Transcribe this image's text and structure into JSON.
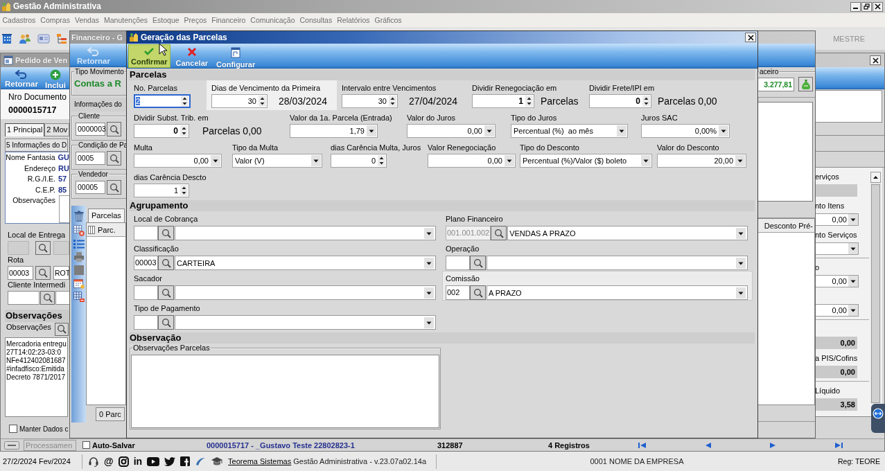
{
  "app_window": {
    "title": "Gestão Administrativa",
    "menu": [
      "Cadastros",
      "Compras",
      "Vendas",
      "Manutenções",
      "Estoque",
      "Preços",
      "Financeiro",
      "Comunicação",
      "Consultas",
      "Relatórios",
      "Gráficos"
    ],
    "toolbar": [
      {
        "kind": "building"
      },
      {
        "kind": "people"
      },
      {
        "kind": "card"
      },
      {
        "kind": "hierarchy"
      }
    ],
    "user": "MESTRE"
  },
  "order_window": {
    "title": "Pedido de Ven",
    "toolbar": [
      {
        "kind": "back",
        "label": "Retornar"
      },
      {
        "kind": "add",
        "label": "Inclui"
      }
    ],
    "document": {
      "label": "Nro Documento",
      "value": "0000015717"
    },
    "tabs": [
      {
        "label": "1 Principal",
        "selected": true
      },
      {
        "label": "2 Mov",
        "selected": false
      }
    ],
    "tabs_row_2": [
      {
        "label": "5 Informações do D",
        "selected": false
      }
    ],
    "customer_info": [
      {
        "kind": "text",
        "label": "Nome Fantasia",
        "value": "GU"
      },
      {
        "kind": "text",
        "label": "Endereço",
        "value": "RU"
      },
      {
        "kind": "text",
        "label": "R.G./I.E.",
        "value": "57"
      },
      {
        "kind": "text",
        "label": "C.E.P.",
        "value": "85"
      },
      {
        "kind": "memo",
        "label": "Observações"
      }
    ],
    "delivery": [
      {
        "label": "Local de Entrega",
        "disabled": true
      },
      {
        "label": "Rota",
        "code": "00003",
        "name": "ROT",
        "disabled": false
      },
      {
        "label": "Cliente Intermedi",
        "disabled": false
      }
    ],
    "notes_section": {
      "title": "Observações",
      "label": "Observações",
      "lines": [
        "Mercadoria entregu",
        "27T14:02:23-03:0",
        "NFe412402081687",
        "#infadfisco:Emitida",
        "Decreto 7871/2017"
      ]
    },
    "keep_data": {
      "label": "Manter Dados c",
      "checked": false
    },
    "totals": [
      {
        "kind": "readonly",
        "label": "erviços"
      },
      {
        "kind": "amount",
        "label": "nto Itens",
        "value": "0,00"
      },
      {
        "kind": "amount",
        "label": "nto Serviços"
      },
      {
        "kind": "amount",
        "label": "o",
        "value": "0,00"
      },
      {
        "kind": "amount",
        "value": "0,00"
      },
      {
        "kind": "readonly",
        "value": "0,00"
      },
      {
        "kind": "readonly",
        "label": "a PIS/Cofins",
        "value": "0,00"
      },
      {
        "kind": "readonly",
        "label": "Líquido",
        "value": "3,58"
      }
    ],
    "status_bar": {
      "process_label": "Processamen",
      "auto_save": {
        "label": "Auto-Salvar",
        "checked": false
      },
      "record": "0000015717 - _Gustavo Teste 22802823-1",
      "code": "312887",
      "count": "4 Registros",
      "navigation": [
        {
          "kind": "first"
        },
        {
          "kind": "prev"
        },
        {
          "kind": "next"
        },
        {
          "kind": "last"
        }
      ]
    }
  },
  "finance_window": {
    "title": "Financeiro - G",
    "toolbar": [
      {
        "kind": "back",
        "label": "Retornar",
        "disabled": true
      }
    ],
    "movement_type": {
      "label": "Tipo Movimento",
      "value": "Contas a R"
    },
    "info_tab": "Informações do",
    "lookups": [
      {
        "label": "Cliente",
        "code": "0000003"
      },
      {
        "label": "Condição de Pa",
        "code": "0005"
      },
      {
        "label": "Vendedor",
        "code": "00005"
      }
    ],
    "side_tools": [
      {
        "kind": "trash"
      },
      {
        "kind": "table-remove"
      },
      {
        "kind": "list"
      },
      {
        "kind": "printer"
      },
      {
        "kind": "square"
      },
      {
        "kind": "calendar"
      },
      {
        "kind": "grid-remove"
      }
    ],
    "tabs": [
      {
        "label": "Parcelas",
        "selected": true
      }
    ],
    "grid_columns": [
      "Parc."
    ],
    "count_button": "0 Parc",
    "balance": {
      "label": "aceiro",
      "value": "3.277,81"
    },
    "right_grid_columns": [
      "Desconto Pré-"
    ]
  },
  "dialog": {
    "title": "Geração das Parcelas",
    "toolbar": [
      {
        "kind": "confirm",
        "label": "Confirmar",
        "hover": true
      },
      {
        "kind": "cancel",
        "label": "Cancelar",
        "hover": false
      },
      {
        "kind": "configure",
        "label": "Configurar",
        "hover": false
      }
    ],
    "parcelas": {
      "title": "Parcelas",
      "rows": [
        [
          {
            "label": "No. Parcelas",
            "kind": "spin",
            "value": "2",
            "focused": true,
            "highlighted": false
          },
          {
            "label": "Dias de Vencimento da Primeira",
            "kind": "spin",
            "value": "30",
            "note": "28/03/2024",
            "focused": false,
            "highlighted": true
          },
          {
            "label": "Intervalo entre Vencimentos",
            "kind": "spin",
            "value": "30",
            "note": "27/04/2024",
            "focused": false,
            "highlighted": false
          },
          {
            "label": "Dividir Renegociação em",
            "kind": "count",
            "value": "1",
            "note": "Parcelas",
            "focused": false,
            "highlighted": false
          },
          {
            "label": "Dividir Frete/IPI em",
            "kind": "count",
            "value": "0",
            "note": "Parcelas 0,00",
            "focused": false,
            "highlighted": false
          }
        ],
        [
          {
            "label": "Dividir Subst. Trib. em",
            "kind": "count",
            "value": "0",
            "note": "Parcelas 0,00",
            "focused": false,
            "highlighted": false
          },
          {
            "label": "Valor da 1a. Parcela (Entrada)",
            "kind": "amount",
            "value": "1,79",
            "focused": false,
            "highlighted": false
          },
          {
            "label": "Valor do Juros",
            "kind": "amount",
            "value": "0,00",
            "focused": false,
            "highlighted": false
          },
          {
            "label": "Tipo do Juros",
            "kind": "select",
            "value": "Percentual (%)  ao mês",
            "focused": false,
            "highlighted": false
          },
          {
            "label": "Juros SAC",
            "kind": "amount",
            "value": "0,00%",
            "focused": false,
            "highlighted": false
          }
        ],
        [
          {
            "label": "Multa",
            "kind": "amount",
            "value": "0,00",
            "focused": false,
            "highlighted": false
          },
          {
            "label": "Tipo da Multa",
            "kind": "select",
            "value": "Valor (V)",
            "focused": false,
            "highlighted": false
          },
          {
            "label": "dias Carência Multa, Juros",
            "kind": "spin",
            "value": "0",
            "focused": false,
            "highlighted": false
          },
          {
            "label": "Valor Renegociação",
            "kind": "amount",
            "value": "0,00",
            "focused": false,
            "highlighted": false
          },
          {
            "label": "Tipo do Desconto",
            "kind": "select",
            "value": "Percentual (%)/Valor ($) boleto",
            "focused": false,
            "highlighted": false
          },
          {
            "label": "Valor do Desconto",
            "kind": "amount",
            "value": "20,00",
            "focused": false,
            "highlighted": false
          }
        ],
        [
          {
            "label": "dias Carência Descto",
            "kind": "spin",
            "value": "1",
            "focused": false,
            "highlighted": false
          }
        ]
      ]
    },
    "agrupamento": {
      "title": "Agrupamento",
      "columns": [
        [
          {
            "label": "Local de Cobrança",
            "disabled": false,
            "highlighted": false
          },
          {
            "label": "Classificação",
            "code": "00003",
            "name": "CARTEIRA",
            "disabled": false,
            "highlighted": false
          },
          {
            "label": "Sacador",
            "disabled": false,
            "highlighted": false
          },
          {
            "label": "Tipo de Pagamento",
            "disabled": false,
            "highlighted": false
          }
        ],
        [
          {
            "label": "Plano Financeiro",
            "code": "001.001.002",
            "name": "VENDAS A PRAZO",
            "disabled": true,
            "highlighted": false
          },
          {
            "label": "Operação",
            "disabled": false,
            "highlighted": false
          },
          {
            "label": "Comissão",
            "code": "002",
            "name": "A PRAZO",
            "disabled": false,
            "highlighted": true
          }
        ]
      ]
    },
    "observacao": {
      "title": "Observação",
      "group_label": "Observações Parcelas"
    }
  },
  "taskbar": {
    "date": "27/2/2024 Fev/2024",
    "links": [
      {
        "kind": "headset"
      },
      {
        "kind": "text",
        "text": "@"
      },
      {
        "kind": "camera"
      },
      {
        "kind": "text",
        "text": "in"
      },
      {
        "kind": "video"
      },
      {
        "kind": "bird"
      },
      {
        "kind": "square-logo"
      },
      {
        "kind": "swoosh"
      },
      {
        "kind": "cap"
      }
    ],
    "company_link": "Teorema Sistemas",
    "version": "Gestão Administrativa - v.23.07a02.14a",
    "company": "0001 NOME DA EMPRESA",
    "registration": "Reg: TEORE"
  }
}
